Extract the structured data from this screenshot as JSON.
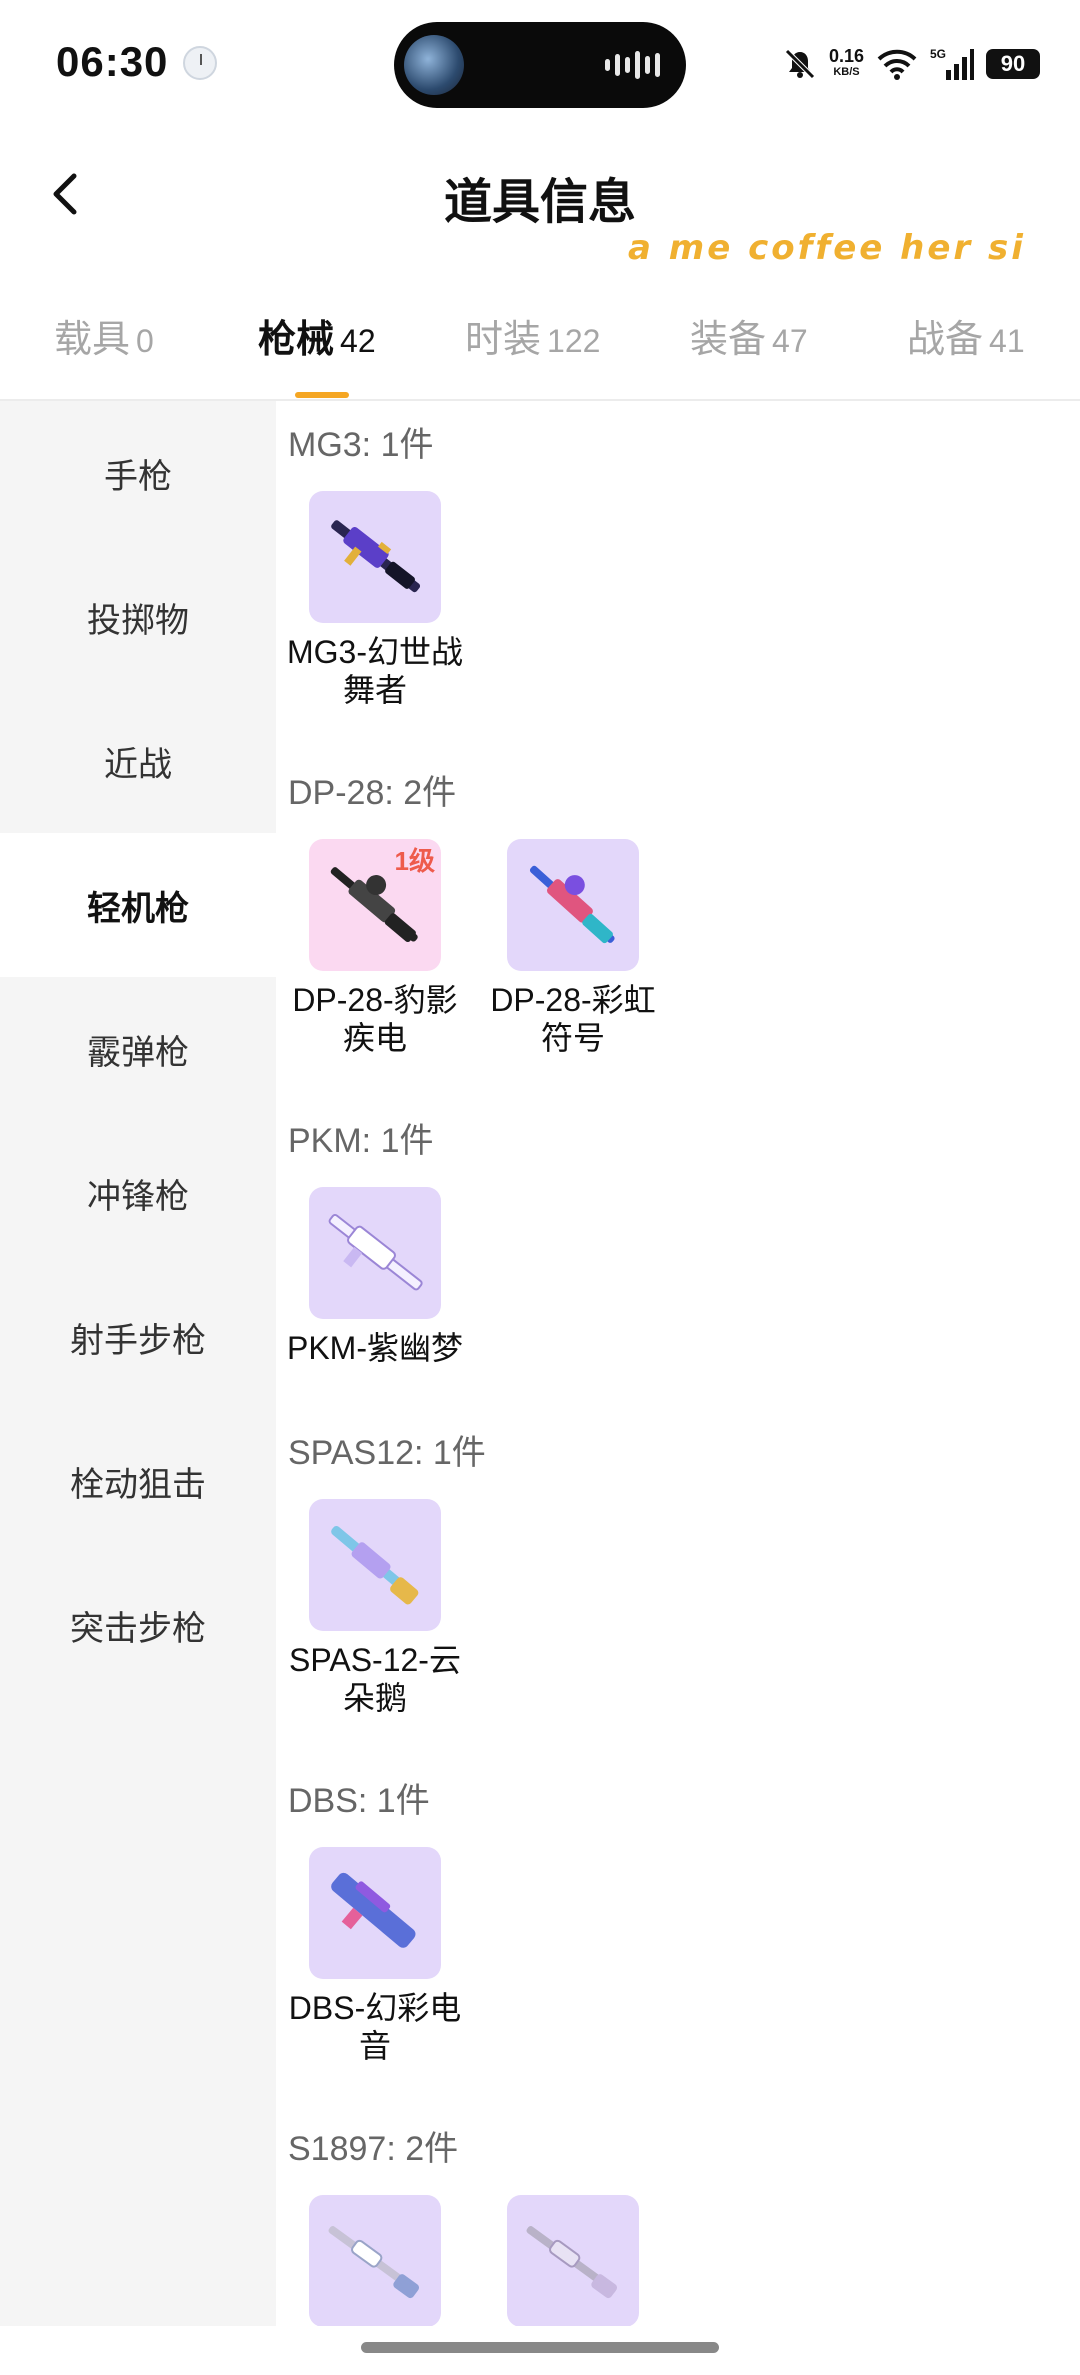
{
  "status_bar": {
    "time": "06:30",
    "network_speed": "0.16",
    "network_speed_unit": "KB/S",
    "network_type": "5G",
    "battery": "90"
  },
  "header": {
    "title": "道具信息",
    "marquee_text": "a me coffee her si"
  },
  "tabs": [
    {
      "label": "载具",
      "count": "0",
      "active": false
    },
    {
      "label": "枪械",
      "count": "42",
      "active": true
    },
    {
      "label": "时装",
      "count": "122",
      "active": false
    },
    {
      "label": "装备",
      "count": "47",
      "active": false
    },
    {
      "label": "战备",
      "count": "41",
      "active": false
    }
  ],
  "sidebar": {
    "items": [
      {
        "label": "手枪"
      },
      {
        "label": "投掷物"
      },
      {
        "label": "近战"
      },
      {
        "label": "轻机枪",
        "active": true
      },
      {
        "label": "霰弹枪"
      },
      {
        "label": "冲锋枪"
      },
      {
        "label": "射手步枪"
      },
      {
        "label": "栓动狙击"
      },
      {
        "label": "突击步枪"
      }
    ]
  },
  "groups": [
    {
      "title": "MG3: 1件",
      "items": [
        {
          "name_line1": "MG3-幻世战",
          "name_line2": "舞者",
          "color": "#e3d7fa"
        }
      ]
    },
    {
      "title": "DP-28: 2件",
      "items": [
        {
          "name_line1": "DP-28-豹影",
          "name_line2": "疾电",
          "badge": "1级",
          "color": "#fbd9f1"
        },
        {
          "name_line1": "DP-28-彩虹",
          "name_line2": "符号",
          "color": "#e3d7fa"
        }
      ]
    },
    {
      "title": "PKM: 1件",
      "items": [
        {
          "name_line1": "PKM-紫幽梦",
          "name_line2": "",
          "color": "#e3d7fa"
        }
      ]
    },
    {
      "title": "SPAS12: 1件",
      "items": [
        {
          "name_line1": "SPAS-12-云",
          "name_line2": "朵鹅",
          "color": "#e3d7fa"
        }
      ]
    },
    {
      "title": "DBS: 1件",
      "items": [
        {
          "name_line1": "DBS-幻彩电",
          "name_line2": "音",
          "color": "#e3d7fa"
        }
      ]
    },
    {
      "title": "S1897: 2件",
      "items": [
        {
          "name_line1": "",
          "name_line2": "",
          "color": "#e3d7fa"
        },
        {
          "name_line1": "",
          "name_line2": "",
          "color": "#e3d7fa"
        }
      ]
    }
  ],
  "colors": {
    "accent": "#f5a623",
    "badge": "#ee5b4c",
    "sidebar_bg": "#f5f5f5",
    "thumb_purple": "#e3d7fa",
    "thumb_pink": "#fbd9f1"
  }
}
